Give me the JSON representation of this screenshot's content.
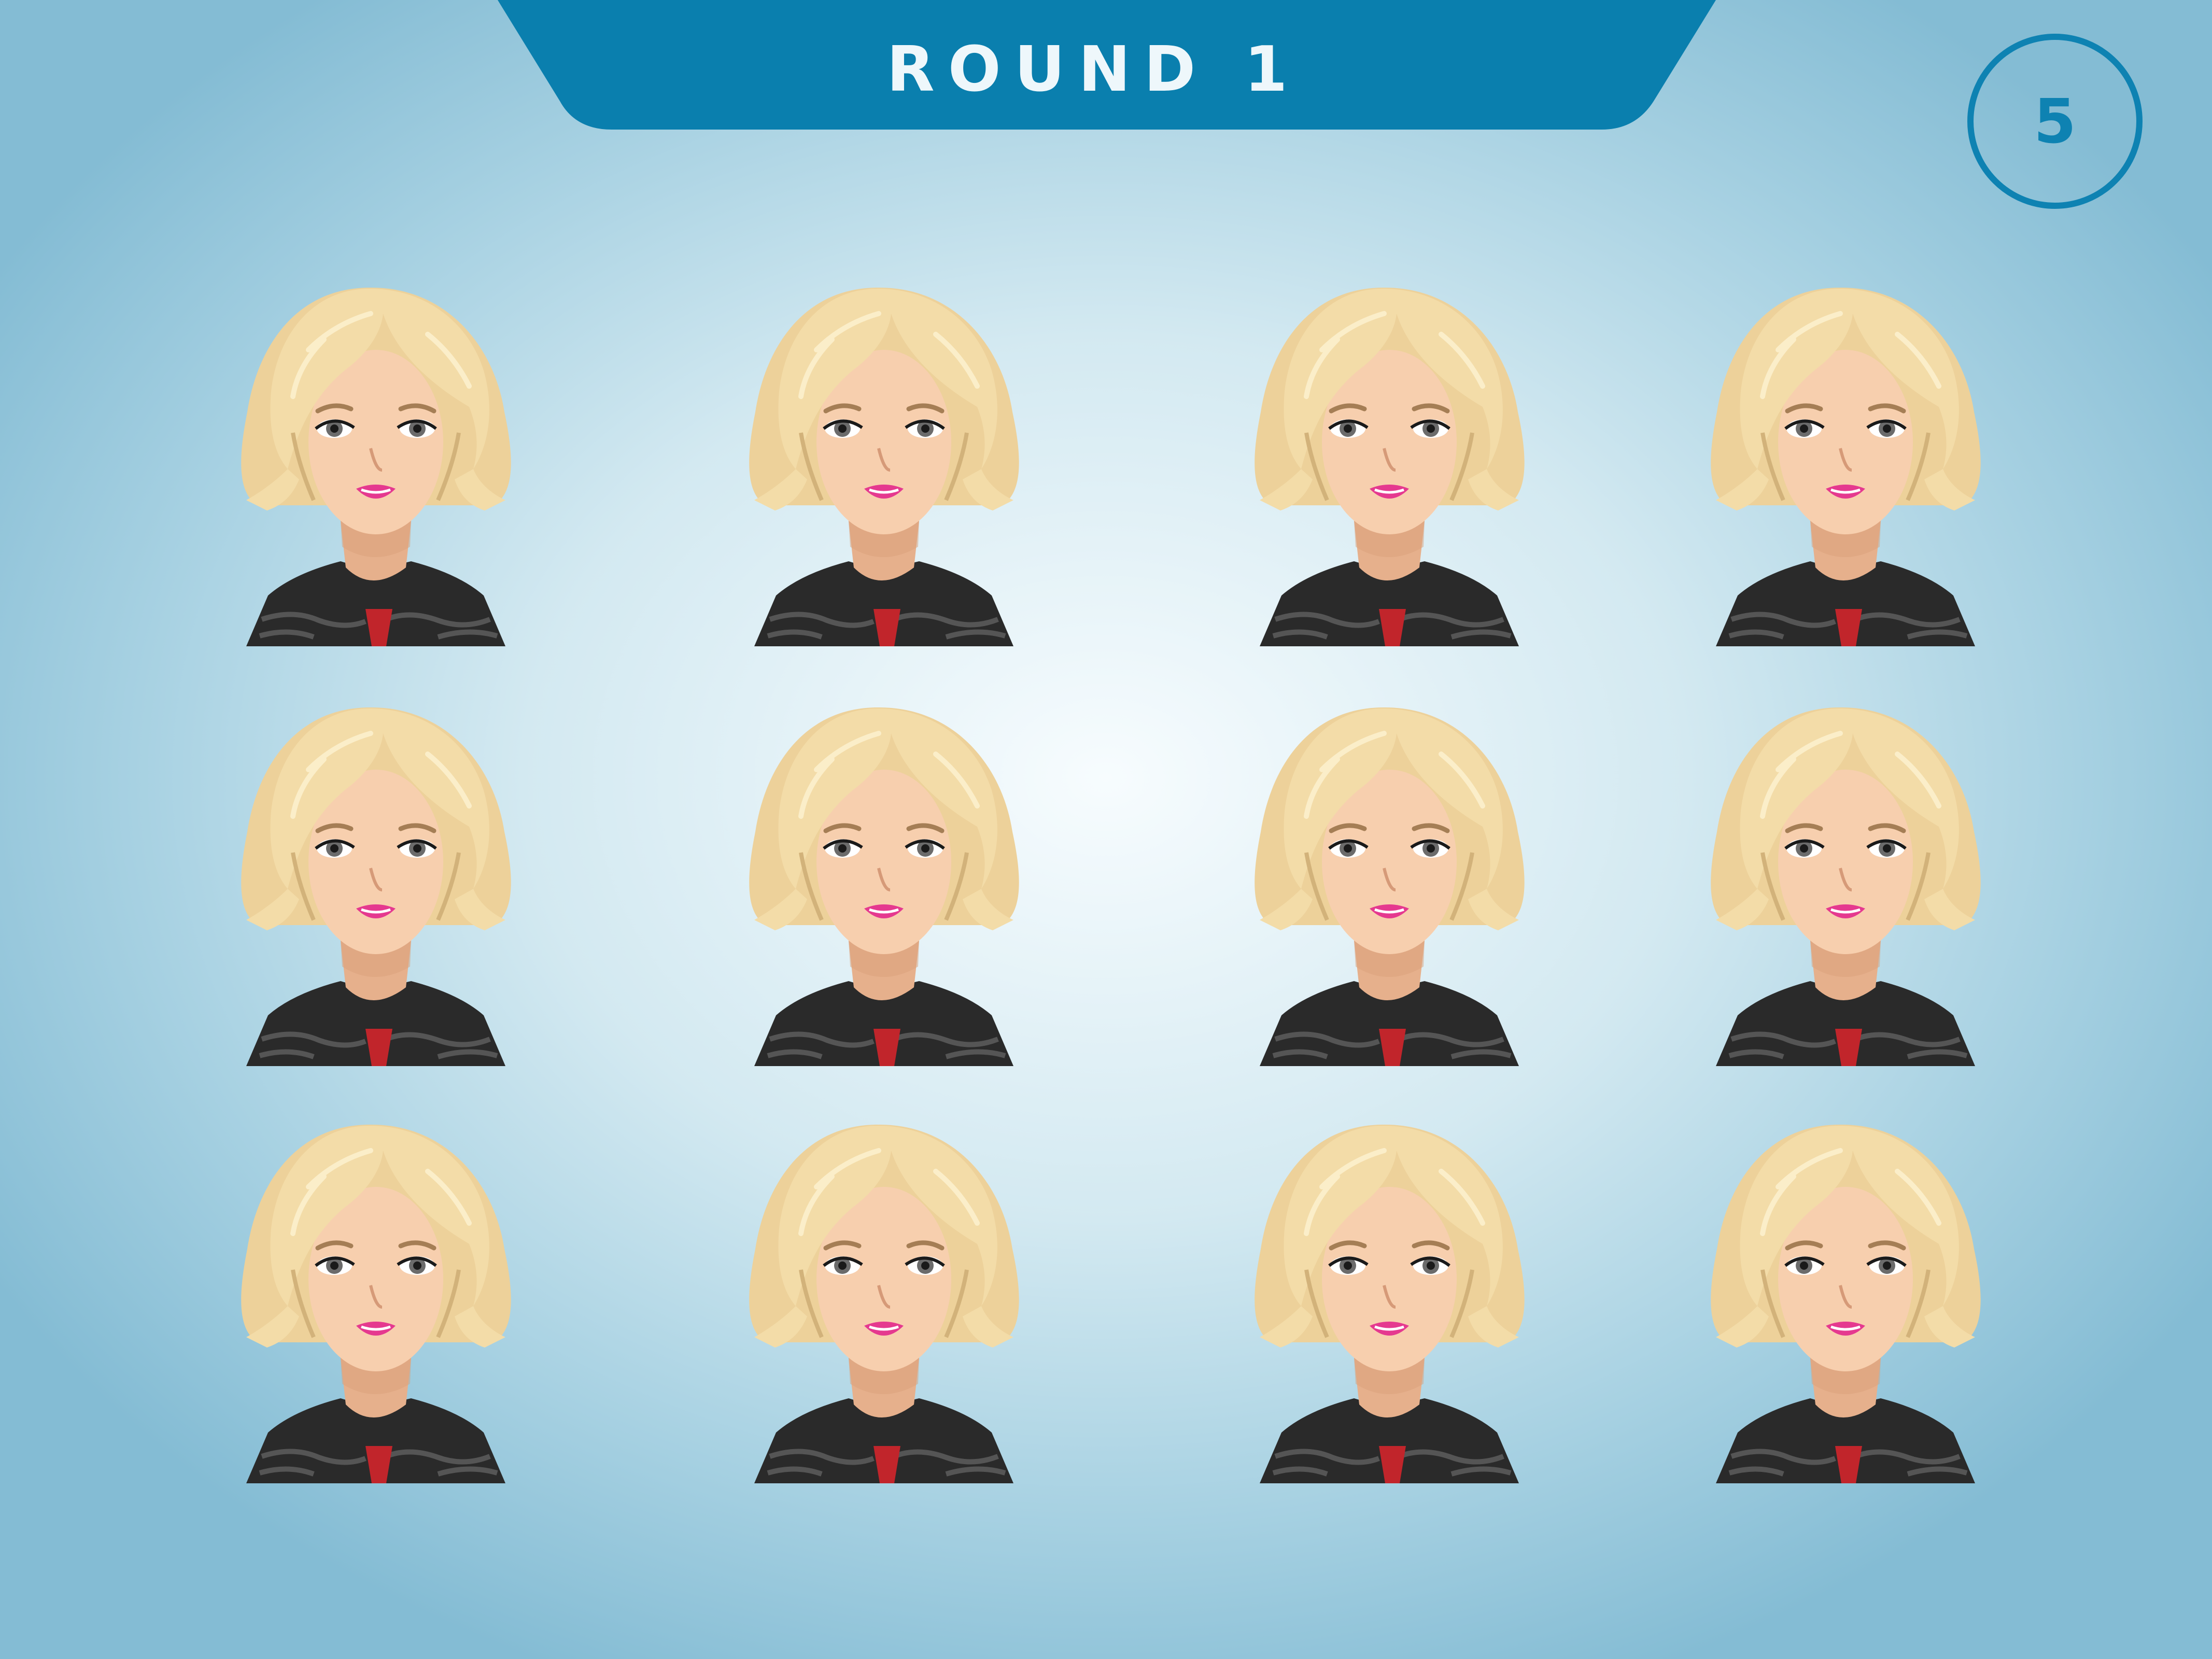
{
  "game": {
    "round_label": "ROUND 1",
    "timer_value": "5"
  },
  "colors": {
    "banner": "#0a7fae",
    "timer_ring": "#0e82b2",
    "hair": "#f3dca8",
    "skin": "#f7cfae",
    "jacket": "#2a2a2a",
    "lips": "#e5398f",
    "shirt": "#c1252b"
  },
  "characters": [
    {
      "id": 1,
      "icon": "blonde-woman-avatar"
    },
    {
      "id": 2,
      "icon": "blonde-woman-avatar"
    },
    {
      "id": 3,
      "icon": "blonde-woman-avatar"
    },
    {
      "id": 4,
      "icon": "blonde-woman-avatar"
    },
    {
      "id": 5,
      "icon": "blonde-woman-avatar"
    },
    {
      "id": 6,
      "icon": "blonde-woman-avatar"
    },
    {
      "id": 7,
      "icon": "blonde-woman-avatar"
    },
    {
      "id": 8,
      "icon": "blonde-woman-avatar"
    },
    {
      "id": 9,
      "icon": "blonde-woman-avatar"
    },
    {
      "id": 10,
      "icon": "blonde-woman-avatar"
    },
    {
      "id": 11,
      "icon": "blonde-woman-avatar"
    },
    {
      "id": 12,
      "icon": "blonde-woman-avatar"
    }
  ]
}
